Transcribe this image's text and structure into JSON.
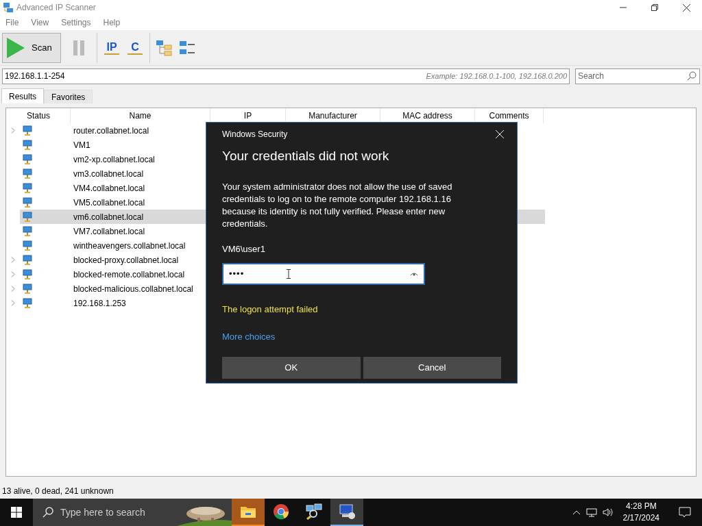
{
  "window": {
    "title": "Advanced IP Scanner"
  },
  "menu": [
    "File",
    "View",
    "Settings",
    "Help"
  ],
  "toolbar": {
    "scan_label": "Scan",
    "pause_disabled": true,
    "ip_label": "IP",
    "c_label": "C"
  },
  "range": {
    "value": "192.168.1.1-254",
    "example": "Example: 192.168.0.1-100, 192.168.0.200"
  },
  "search": {
    "placeholder": "Search"
  },
  "tabs": [
    {
      "label": "Results",
      "selected": true
    },
    {
      "label": "Favorites",
      "selected": false
    }
  ],
  "table": {
    "columns": [
      "Status",
      "Name",
      "IP",
      "Manufacturer",
      "MAC address",
      "Comments"
    ],
    "rows": [
      {
        "name": "router.collabnet.local",
        "expandable": true,
        "selected": false
      },
      {
        "name": "VM1",
        "expandable": false,
        "selected": false
      },
      {
        "name": "vm2-xp.collabnet.local",
        "expandable": false,
        "selected": false
      },
      {
        "name": "vm3.collabnet.local",
        "expandable": false,
        "selected": false
      },
      {
        "name": "VM4.collabnet.local",
        "expandable": false,
        "selected": false
      },
      {
        "name": "VM5.collabnet.local",
        "expandable": false,
        "selected": false
      },
      {
        "name": "vm6.collabnet.local",
        "expandable": false,
        "selected": true
      },
      {
        "name": "VM7.collabnet.local",
        "expandable": false,
        "selected": false
      },
      {
        "name": "wintheavengers.collabnet.local",
        "expandable": false,
        "selected": false
      },
      {
        "name": "blocked-proxy.collabnet.local",
        "expandable": true,
        "selected": false
      },
      {
        "name": "blocked-remote.collabnet.local",
        "expandable": true,
        "selected": false
      },
      {
        "name": "blocked-malicious.collabnet.local",
        "expandable": true,
        "selected": false
      },
      {
        "name": "192.168.1.253",
        "expandable": true,
        "selected": false
      }
    ]
  },
  "status_bar": "13 alive, 0 dead, 241 unknown",
  "dialog": {
    "caption": "Windows Security",
    "title": "Your credentials did not work",
    "message": "Your system administrator does not allow the use of saved credentials to log on to the remote computer 192.168.1.16 because its identity is not fully verified. Please enter new credentials.",
    "user": "VM6\\user1",
    "password": "••••",
    "error": "The logon attempt failed",
    "link": "More choices",
    "buttons": [
      "OK",
      "Cancel"
    ]
  },
  "taskbar": {
    "search_placeholder": "Type here to search",
    "apps": [
      {
        "kind": "folder",
        "flashing": true,
        "active": false
      },
      {
        "kind": "browser",
        "flashing": false,
        "active": false
      },
      {
        "kind": "scanner",
        "flashing": false,
        "active": false
      },
      {
        "kind": "remote",
        "flashing": false,
        "active": true
      }
    ],
    "time": "4:28 PM",
    "date": "2/17/2024"
  }
}
